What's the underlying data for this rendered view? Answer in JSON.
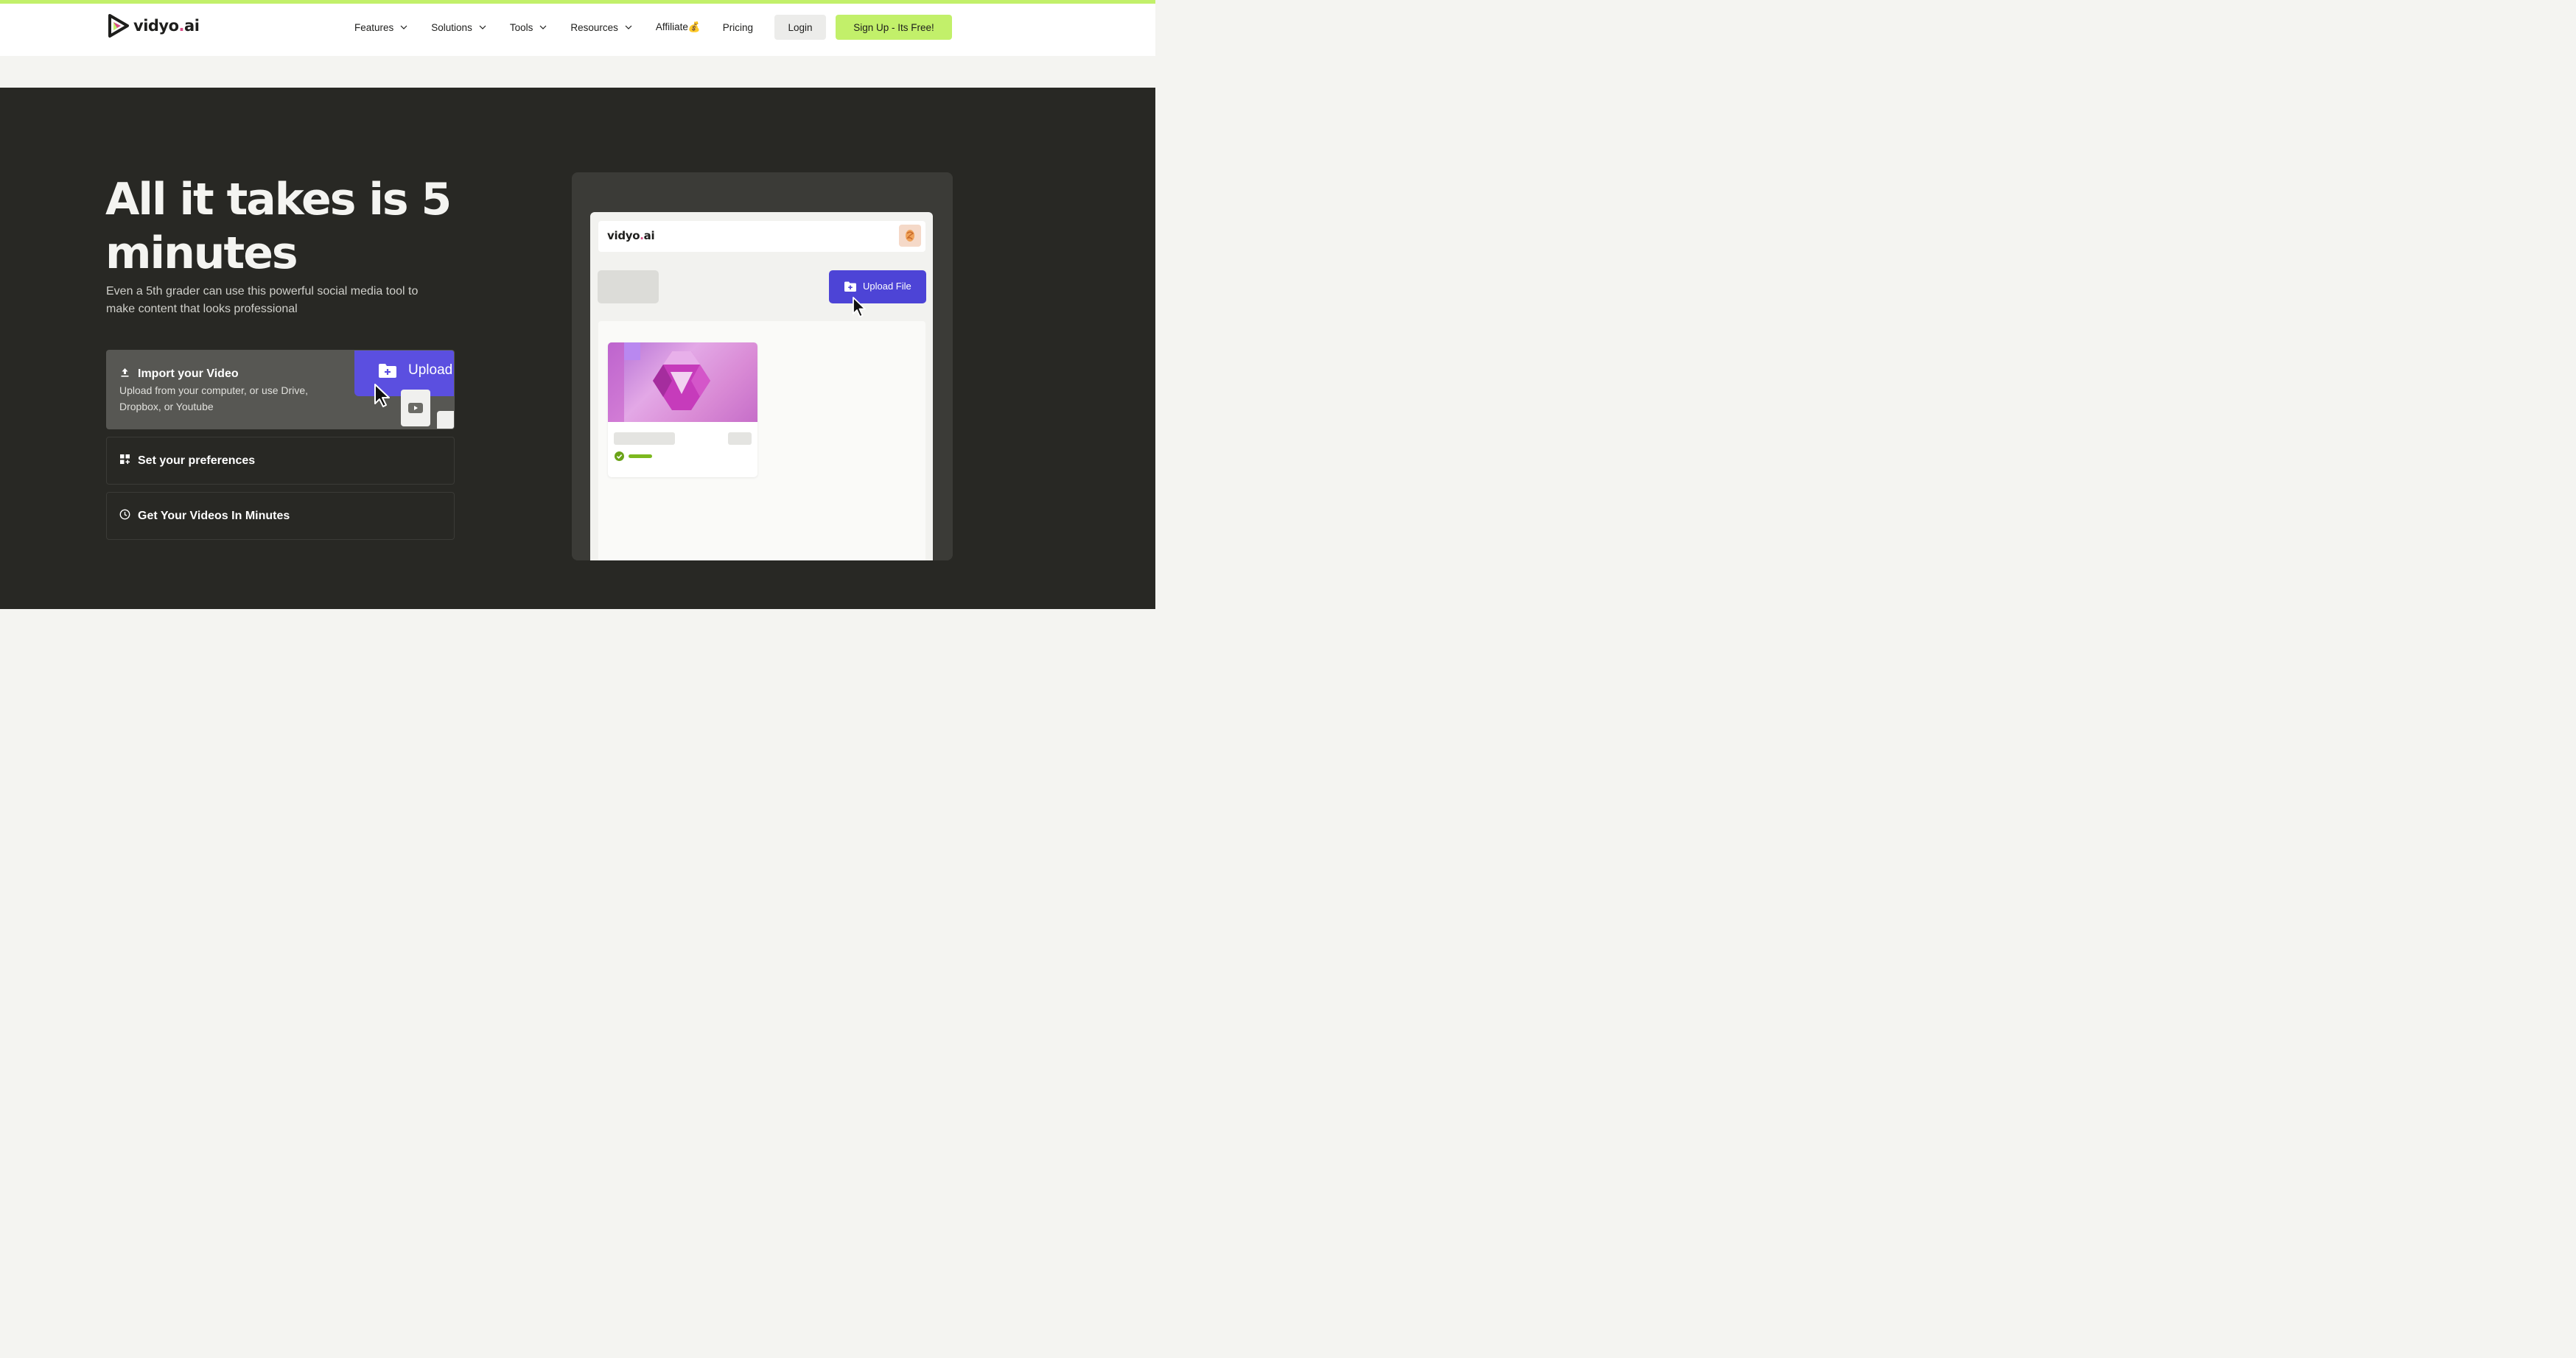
{
  "brand": {
    "name_main": "vidyo",
    "name_dot": ".",
    "name_suffix": "ai",
    "accent_color": "#c2f06a",
    "dot_color": "#d84c86"
  },
  "nav": {
    "items": [
      {
        "label": "Features",
        "has_dropdown": true
      },
      {
        "label": "Solutions",
        "has_dropdown": true
      },
      {
        "label": "Tools",
        "has_dropdown": true
      },
      {
        "label": "Resources",
        "has_dropdown": true
      },
      {
        "label": "Affiliate💰",
        "has_dropdown": false
      },
      {
        "label": "Pricing",
        "has_dropdown": false
      }
    ],
    "login_label": "Login",
    "signup_label": "Sign Up - Its Free!"
  },
  "hero": {
    "headline": "All it takes is 5 minutes",
    "subtext": "Even a 5th grader can use this powerful social media tool to make content that looks professional",
    "background": "#282824"
  },
  "steps": [
    {
      "icon": "upload-icon",
      "title": "Import your Video",
      "description": "Upload from your computer, or use Drive, Dropbox, or Youtube",
      "active": true,
      "preview_label": "Upload"
    },
    {
      "icon": "grid-icon",
      "title": "Set your preferences",
      "active": false
    },
    {
      "icon": "clock-icon",
      "title": "Get Your Videos In Minutes",
      "active": false
    }
  ],
  "mockup": {
    "logo_main": "vidyo",
    "logo_dot": ".",
    "logo_suffix": "ai",
    "upload_label": "Upload File",
    "upload_color": "#4d44d6"
  }
}
